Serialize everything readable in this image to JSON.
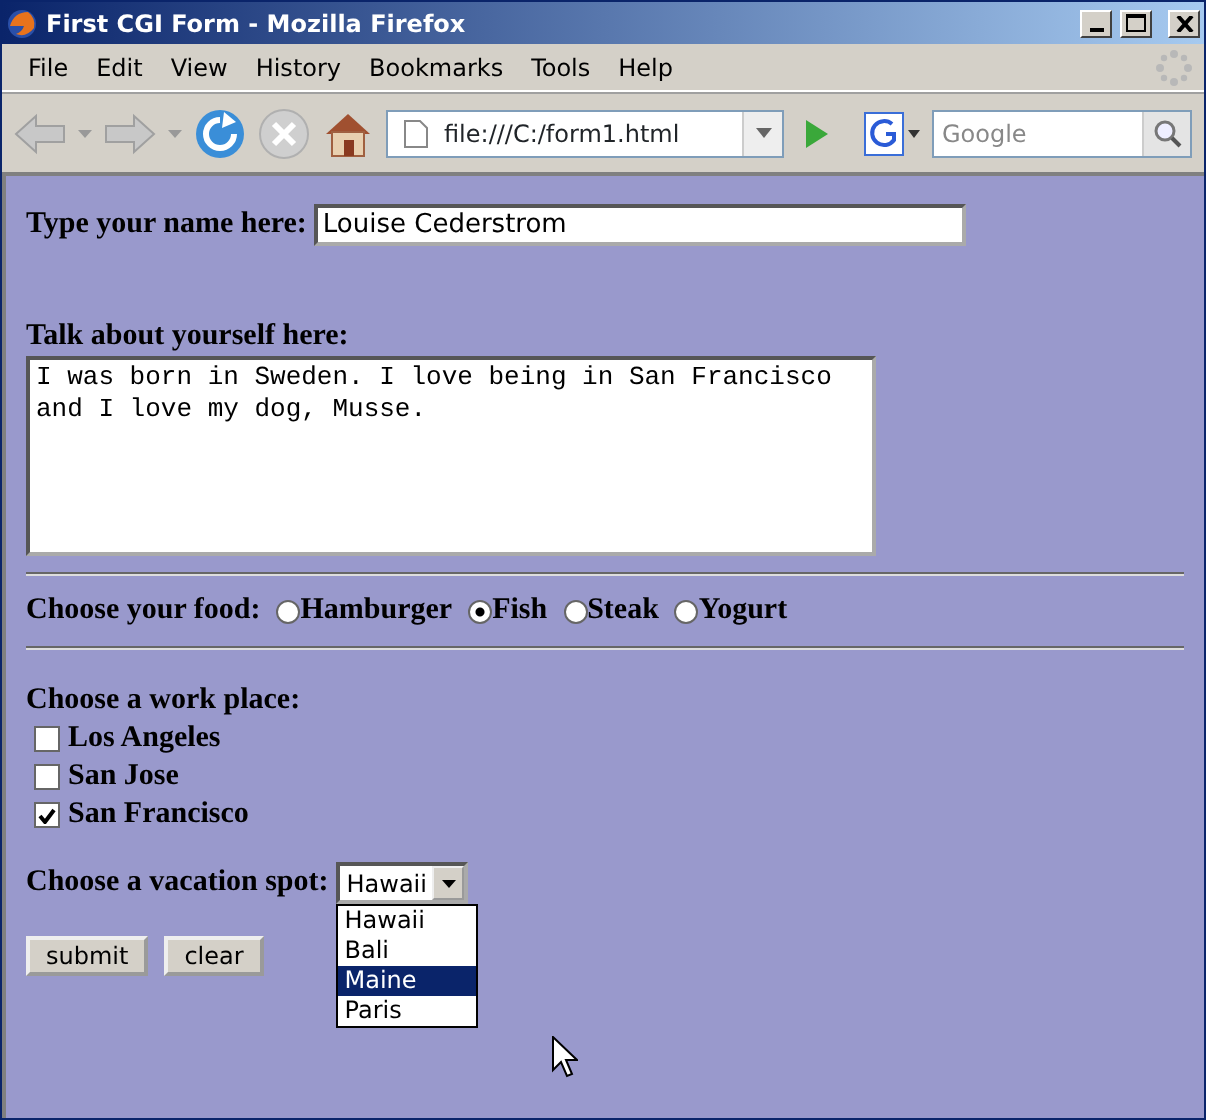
{
  "window": {
    "title": "First CGI Form - Mozilla Firefox"
  },
  "menu": [
    "File",
    "Edit",
    "View",
    "History",
    "Bookmarks",
    "Tools",
    "Help"
  ],
  "toolbar": {
    "address": "file:///C:/form1.html",
    "search_placeholder": "Google"
  },
  "form": {
    "name_label": "Type your name here:",
    "name_value": "Louise Cederstrom",
    "about_label": "Talk about yourself here:",
    "about_value": "I was born in Sweden. I love being in San Francisco and I love my dog, Musse.",
    "food_label": "Choose your food:",
    "foods": [
      {
        "label": "Hamburger",
        "selected": false
      },
      {
        "label": "Fish",
        "selected": true
      },
      {
        "label": "Steak",
        "selected": false
      },
      {
        "label": "Yogurt",
        "selected": false
      }
    ],
    "work_label": "Choose a work place:",
    "work_places": [
      {
        "label": "Los Angeles",
        "checked": false
      },
      {
        "label": "San Jose",
        "checked": false
      },
      {
        "label": "San Francisco",
        "checked": true
      }
    ],
    "vacation_label": "Choose a vacation spot:",
    "vacation_value": "Hawaii",
    "vacation_options": [
      {
        "label": "Hawaii",
        "selected": false
      },
      {
        "label": "Bali",
        "selected": false
      },
      {
        "label": "Maine",
        "selected": true
      },
      {
        "label": "Paris",
        "selected": false
      }
    ],
    "buttons": [
      "submit",
      "clear"
    ]
  }
}
